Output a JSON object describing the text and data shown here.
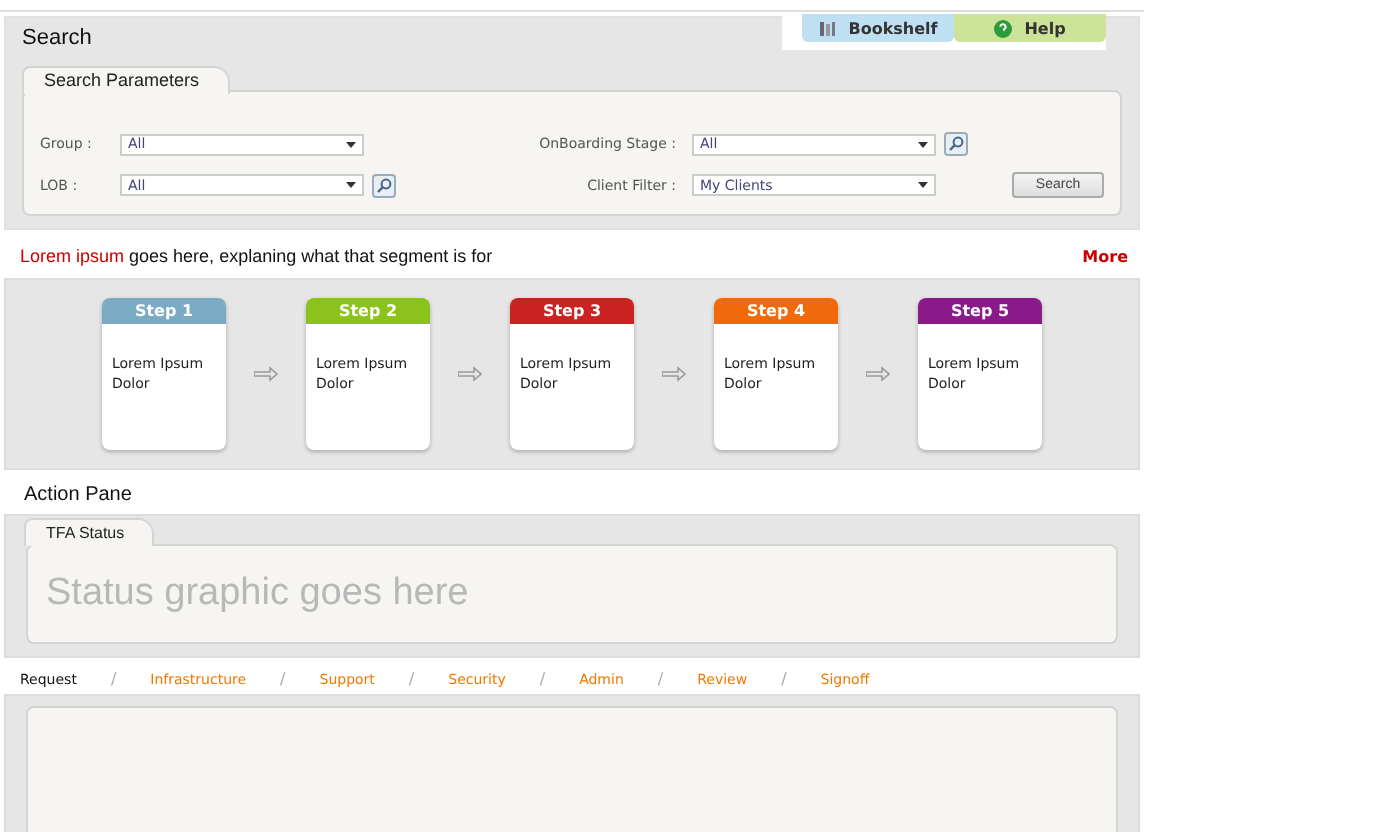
{
  "top_tabs": [
    {
      "label": "Bookshelf",
      "kind": "bookshelf"
    },
    {
      "label": "Help",
      "kind": "help"
    }
  ],
  "search": {
    "title": "Search",
    "section_title": "Search Parameters",
    "fields": [
      {
        "label": "Group :",
        "value": "All",
        "lookup": false
      },
      {
        "label": "OnBoarding Stage :",
        "value": "All",
        "lookup": true
      },
      {
        "label": "LOB :",
        "value": "All",
        "lookup": true
      },
      {
        "label": "Client Filter :",
        "value": "My Clients",
        "lookup": false
      }
    ],
    "button": "Search"
  },
  "intro": {
    "highlight": "Lorem ipsum",
    "text": " goes here, explaning what that segment is for",
    "more": "More"
  },
  "steps": [
    {
      "title": "Step 1",
      "text": "Lorem Ipsum Dolor",
      "color": "#7aaac4"
    },
    {
      "title": "Step 2",
      "text": "Lorem Ipsum Dolor",
      "color": "#8cc21c"
    },
    {
      "title": "Step 3",
      "text": "Lorem Ipsum Dolor",
      "color": "#cc2222"
    },
    {
      "title": "Step 4",
      "text": "Lorem Ipsum Dolor",
      "color": "#f06a0c"
    },
    {
      "title": "Step 5",
      "text": "Lorem Ipsum Dolor",
      "color": "#8a1a8a"
    }
  ],
  "action_pane": {
    "title": "Action Pane",
    "status_tab": "TFA Status",
    "placeholder": "Status graphic goes here"
  },
  "tab_separator": "/",
  "tabs": [
    {
      "label": "Request",
      "selected": true
    },
    {
      "label": "Infrastructure",
      "selected": false
    },
    {
      "label": "Support",
      "selected": false
    },
    {
      "label": "Security",
      "selected": false
    },
    {
      "label": "Admin",
      "selected": false
    },
    {
      "label": "Review",
      "selected": false
    },
    {
      "label": "Signoff",
      "selected": false
    }
  ]
}
